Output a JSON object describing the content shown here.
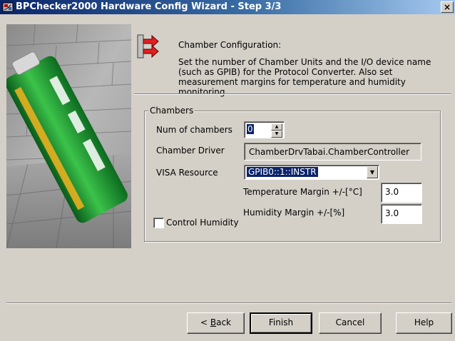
{
  "window": {
    "title": "BPChecker2000 Hardware Config Wizard - Step 3/3",
    "close_label": "×",
    "app_icon": "wizard-app-icon"
  },
  "header": {
    "icon": "arrows-icon",
    "heading": "Chamber Configuration:",
    "description": "Set the number of Chamber Units and the I/O device name (such as GPIB) for the Protocol Converter.  Also set measurement margins for temperature and humidity monitoring."
  },
  "side_image": {
    "icon": "battery-image"
  },
  "chambers": {
    "group_label": "Chambers",
    "num_label": "Num of chambers",
    "num_value": "0",
    "driver_label": "Chamber Driver",
    "driver_value": "ChamberDrvTabai.ChamberController",
    "visa_label": "VISA Resource",
    "visa_value": "GPIB0::1::INSTR",
    "temp_label": "Temperature Margin +/-[°C]",
    "temp_value": "3.0",
    "humidity_label": "Humidity Margin +/-[%]",
    "humidity_value": "3.0",
    "control_humidity_label": "Control Humidity",
    "control_humidity_checked": false
  },
  "buttons": {
    "back_prefix": "< ",
    "back_key": "B",
    "back_rest": "ack",
    "finish": "Finish",
    "cancel": "Cancel",
    "help": "Help"
  }
}
